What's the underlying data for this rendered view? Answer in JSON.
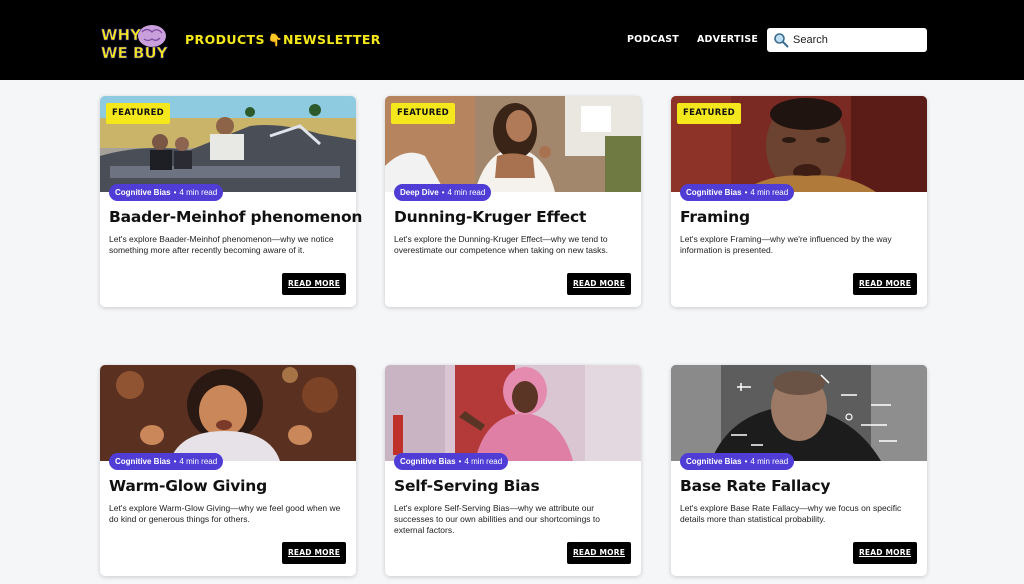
{
  "header": {
    "logo": {
      "line1": "WHY",
      "line2": "WE BUY"
    },
    "nav_primary": [
      {
        "label": "PRODUCTS",
        "icon": "pointing-down-icon",
        "glyph": "👇"
      },
      {
        "label": "NEWSLETTER"
      }
    ],
    "nav_secondary": [
      {
        "label": "PODCAST"
      },
      {
        "label": "ADVERTISE"
      }
    ],
    "search": {
      "placeholder": "Search",
      "icon": "search-icon"
    }
  },
  "colors": {
    "brand_yellow": "#f4e81c",
    "tag_purple": "#4f3dd6",
    "header_bg": "#000000",
    "page_bg": "#f5f6f8"
  },
  "cards": [
    {
      "featured": "FEATURED",
      "category": "Cognitive Bias",
      "dot": "•",
      "read_time": "4 min read",
      "title": "Baader-Meinhof phenomenon",
      "description": "Let's explore Baader-Meinhof phenomenon—why we notice something more after recently becoming aware of it.",
      "button": "READ MORE"
    },
    {
      "featured": "FEATURED",
      "category": "Deep Dive",
      "dot": "•",
      "read_time": "4 min read",
      "title": "Dunning-Kruger Effect",
      "description": "Let's explore the Dunning-Kruger Effect—why we tend to overestimate our competence when taking on new tasks.",
      "button": "READ MORE"
    },
    {
      "featured": "FEATURED",
      "category": "Cognitive Bias",
      "dot": "•",
      "read_time": "4 min read",
      "title": "Framing",
      "description": "Let's explore Framing—why we're influenced by the way information is presented.",
      "button": "READ MORE"
    },
    {
      "category": "Cognitive Bias",
      "dot": "•",
      "read_time": "4 min read",
      "title": "Warm-Glow Giving",
      "description": "Let's explore Warm-Glow Giving—why we feel good when we do kind or generous things for others.",
      "button": "READ MORE"
    },
    {
      "category": "Cognitive Bias",
      "dot": "•",
      "read_time": "4 min read",
      "title": "Self-Serving Bias",
      "description": "Let's explore Self-Serving Bias—why we attribute our successes to our own abilities and our shortcomings to external factors.",
      "button": "READ MORE"
    },
    {
      "category": "Cognitive Bias",
      "dot": "•",
      "read_time": "4 min read",
      "title": "Base Rate Fallacy",
      "description": "Let's explore Base Rate Fallacy—why we focus on specific details more than statistical probability.",
      "button": "READ MORE"
    }
  ]
}
